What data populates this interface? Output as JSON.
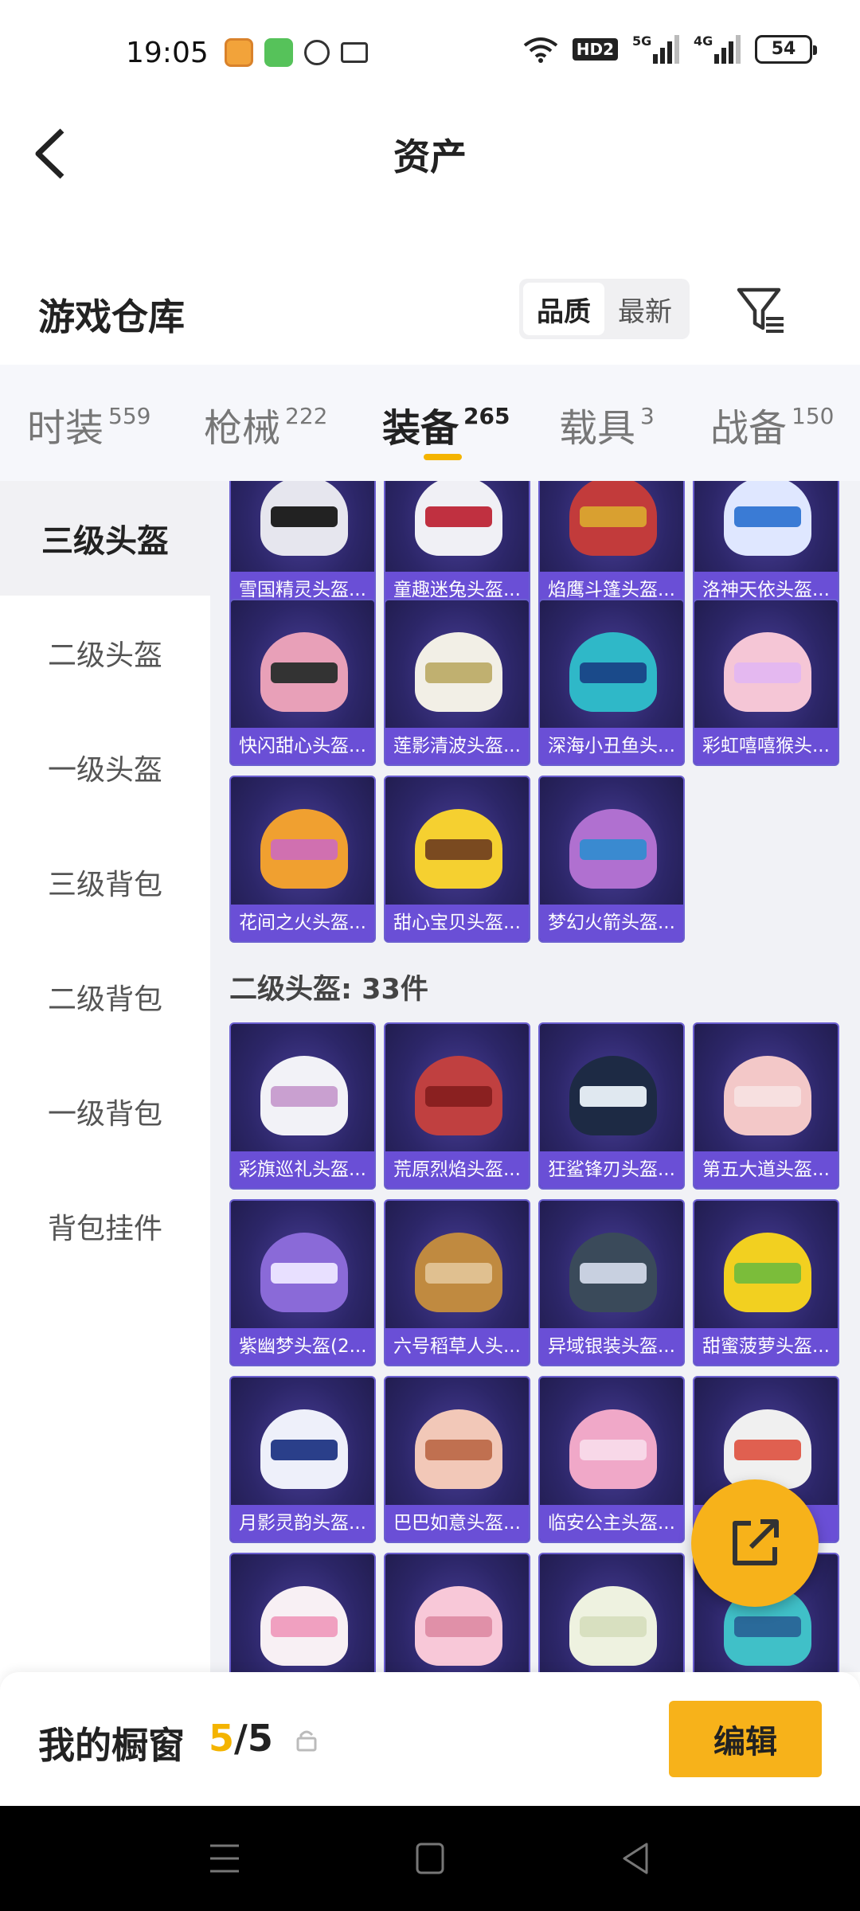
{
  "status_bar": {
    "time": "19:05",
    "hd": "HD2",
    "sig1": "5G",
    "sig2": "4G",
    "battery": "54"
  },
  "header": {
    "title": "资产"
  },
  "warehouse": {
    "title": "游戏仓库",
    "sort_options": [
      "品质",
      "最新"
    ]
  },
  "tabs": [
    {
      "label": "时装",
      "count": "559"
    },
    {
      "label": "枪械",
      "count": "222"
    },
    {
      "label": "装备",
      "count": "265"
    },
    {
      "label": "载具",
      "count": "3"
    },
    {
      "label": "战备",
      "count": "150"
    }
  ],
  "sidebar": {
    "items": [
      "三级头盔",
      "二级头盔",
      "一级头盔",
      "三级背包",
      "二级背包",
      "一级背包",
      "背包挂件"
    ]
  },
  "sections": [
    {
      "items": [
        "雪国精灵头盔...",
        "童趣迷兔头盔...",
        "焰鹰斗篷头盔...",
        "洛神天依头盔...",
        "快闪甜心头盔...",
        "莲影清波头盔...",
        "深海小丑鱼头...",
        "彩虹嘻嘻猴头...",
        "花间之火头盔...",
        "甜心宝贝头盔...",
        "梦幻火箭头盔..."
      ]
    },
    {
      "label": "二级头盔: 33件",
      "items": [
        "彩旗巡礼头盔...",
        "荒原烈焰头盔...",
        "狂鲨锋刃头盔...",
        "第五大道头盔...",
        "紫幽梦头盔(2...",
        "六号稻草人头...",
        "异域银装头盔...",
        "甜蜜菠萝头盔...",
        "月影灵韵头盔...",
        "巴巴如意头盔...",
        "临安公主头盔...",
        "...",
        "",
        "",
        "",
        ""
      ]
    }
  ],
  "bottom": {
    "label": "我的橱窗",
    "current": "5",
    "sep": "/",
    "total": "5",
    "edit_label": "编辑"
  },
  "colors": {
    "accent": "#f7b21a",
    "card_label": "#6a4fd6"
  }
}
